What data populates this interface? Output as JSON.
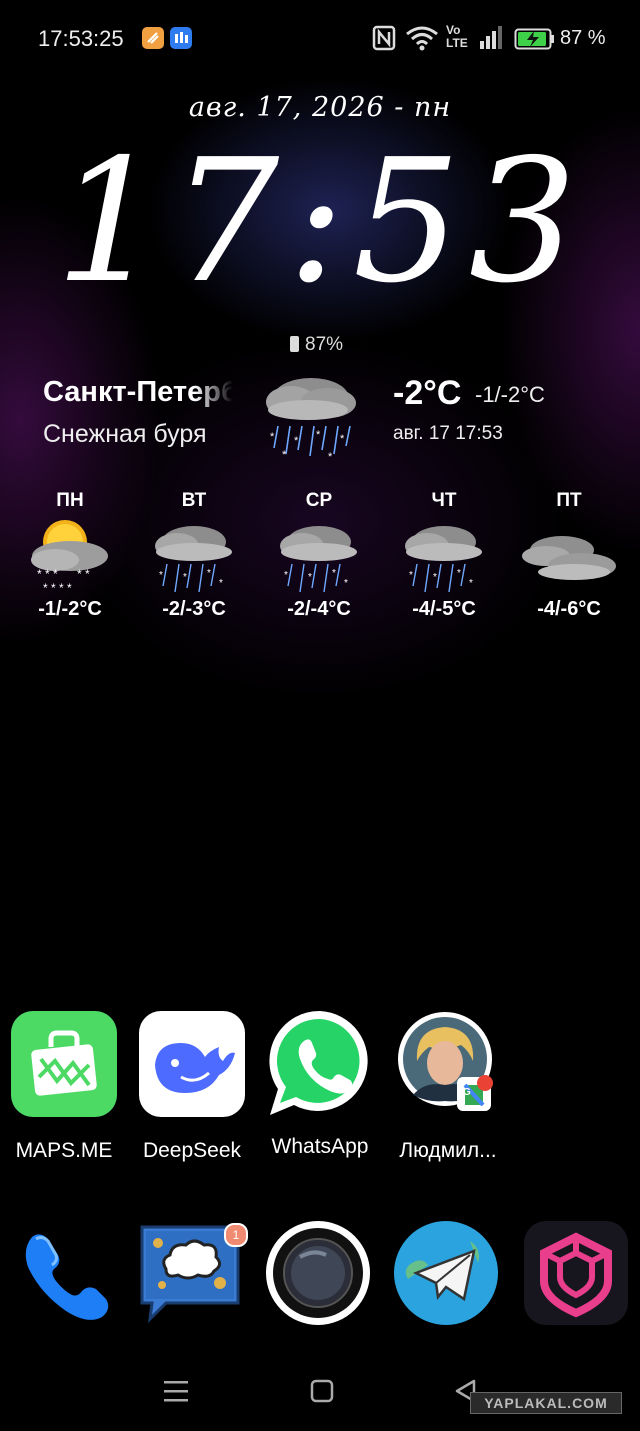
{
  "status_bar": {
    "time": "17:53:25",
    "battery_percent": "87 %",
    "network_label_top": "Vo",
    "network_label_bottom": "LTE",
    "icons": [
      "app-notification-icon",
      "app-notification-icon",
      "nfc-icon",
      "wifi-icon",
      "volte-icon",
      "signal-icon",
      "battery-charging-icon"
    ]
  },
  "clock_widget": {
    "date": "авг. 17, 2026 - пн",
    "time": "17:53"
  },
  "weather_widget": {
    "battery": "87%",
    "city": "Санкт-Петербург",
    "condition": "Снежная буря",
    "current_icon": "snowstorm-icon",
    "current_temp": "-2°C",
    "range": "-1/-2°C",
    "updated": "авг. 17   17:53",
    "forecast": [
      {
        "day": "ПН",
        "temp": "-1/-2°C",
        "icon": "sun-cloud-snow-icon"
      },
      {
        "day": "ВТ",
        "temp": "-2/-3°C",
        "icon": "snowstorm-icon"
      },
      {
        "day": "СР",
        "temp": "-2/-4°C",
        "icon": "snowstorm-icon"
      },
      {
        "day": "ЧТ",
        "temp": "-4/-5°C",
        "icon": "snowstorm-icon"
      },
      {
        "day": "ПТ",
        "temp": "-4/-6°C",
        "icon": "cloudy-icon"
      }
    ]
  },
  "apps": [
    {
      "label": "MAPS.ME",
      "icon": "maps-me-icon"
    },
    {
      "label": "DeepSeek",
      "icon": "deepseek-whale-icon"
    },
    {
      "label": "WhatsApp",
      "icon": "whatsapp-icon"
    },
    {
      "label": "Людмил...",
      "icon": "contact-avatar-icon"
    }
  ],
  "dock": [
    {
      "icon": "phone-icon"
    },
    {
      "icon": "messages-icon",
      "badge": "1"
    },
    {
      "icon": "camera-icon"
    },
    {
      "icon": "telegram-icon"
    },
    {
      "icon": "vpn-shield-icon"
    }
  ],
  "nav_bar": [
    "menu-icon",
    "home-icon",
    "back-icon"
  ],
  "watermark": "YAPLAKAL.COM",
  "colors": {
    "maps_green": "#4cd964",
    "whatsapp_green": "#25d366",
    "telegram_blue": "#2aa3de",
    "vpn_pink": "#e83e8c",
    "battery_green": "#3fd04a"
  }
}
